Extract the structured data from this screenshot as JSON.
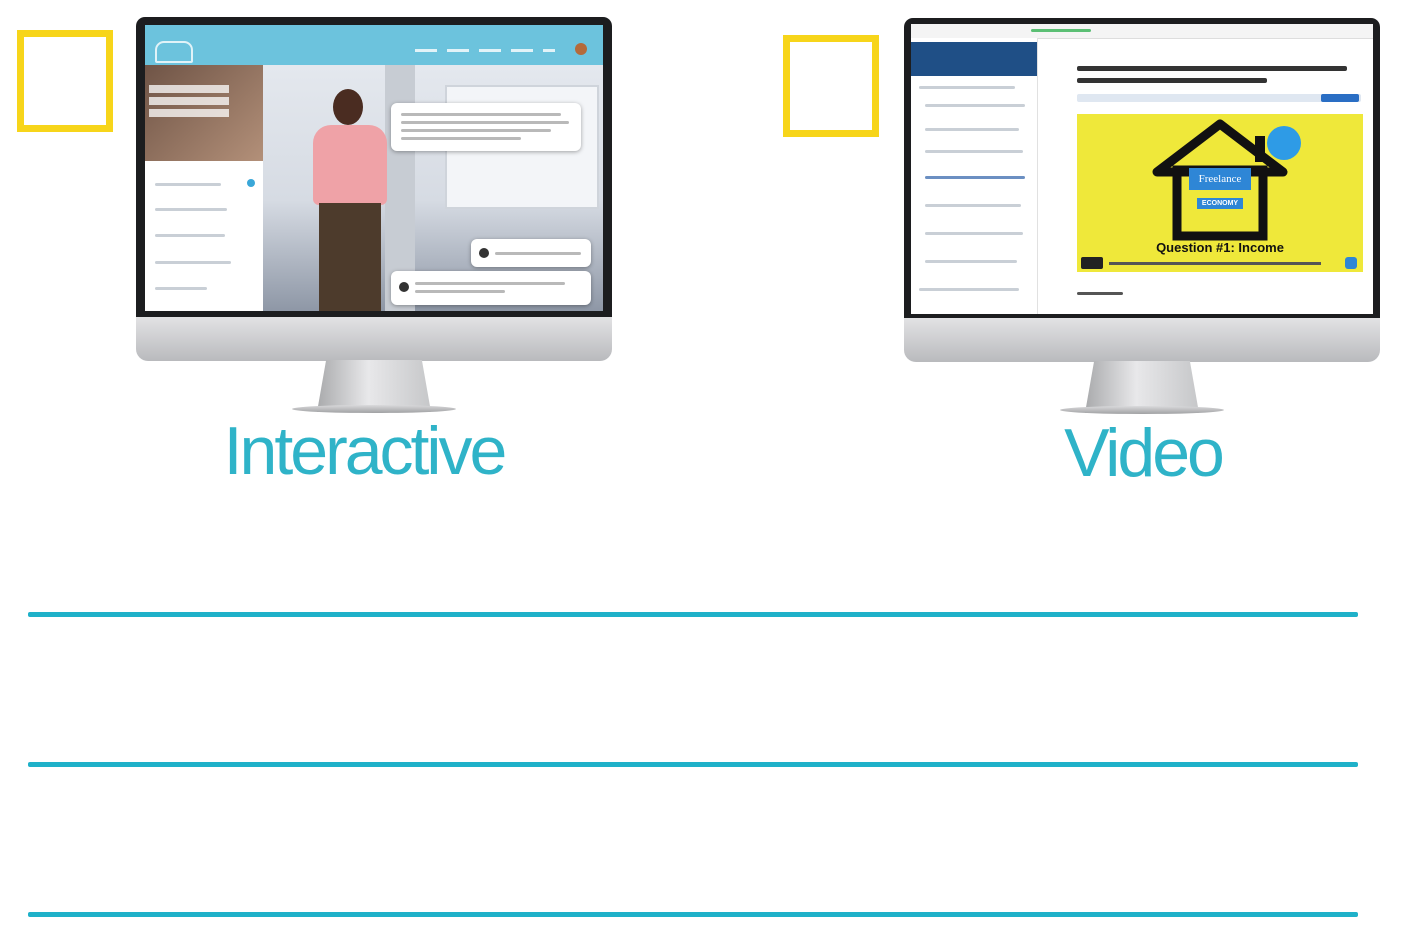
{
  "options": [
    {
      "label": "Interactive",
      "checked": false
    },
    {
      "label": "Video",
      "checked": false
    }
  ],
  "video_thumb": {
    "logo_top": "Freelance",
    "logo_bottom": "ECONOMY",
    "caption": "Question #1: Income"
  },
  "colors": {
    "accent": "#2fb3c8",
    "checkbox_border": "#f7d51a",
    "rule": "#1fb1c9"
  },
  "answer_lines": 3
}
